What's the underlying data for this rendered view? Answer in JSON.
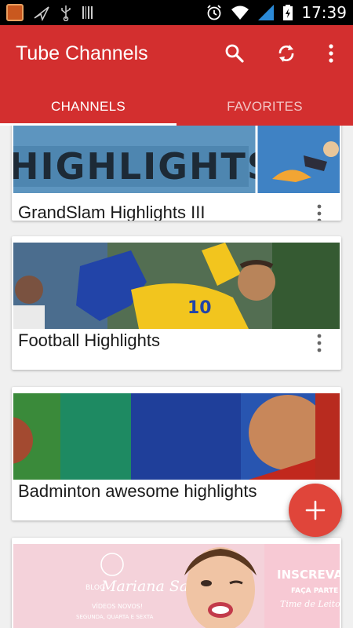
{
  "status_bar": {
    "time": "17:39"
  },
  "app_bar": {
    "title": "Tube Channels",
    "tabs": [
      {
        "label": "CHANNELS",
        "selected": true
      },
      {
        "label": "FAVORITES",
        "selected": false
      }
    ]
  },
  "thumbnail_text": {
    "tennis_banner": "HIGHLIGHTS III",
    "football_number": "10",
    "mariana_brand_top": "BLOG",
    "mariana_brand": "Mariana Saad",
    "mariana_videos": "VÍDEOS NOVOS!",
    "mariana_days": "SEGUNDA, QUARTA E SEXTA",
    "mariana_subscribe": "INSCREVA",
    "mariana_join": "FAÇA PARTE",
    "mariana_team": "Time de Leitoras"
  },
  "channels": [
    {
      "title": "GrandSlam Highlights III"
    },
    {
      "title": "Football Highlights"
    },
    {
      "title": "Badminton awesome highlights"
    }
  ],
  "colors": {
    "primary": "#d32f2f",
    "accent": "#e0453a"
  }
}
